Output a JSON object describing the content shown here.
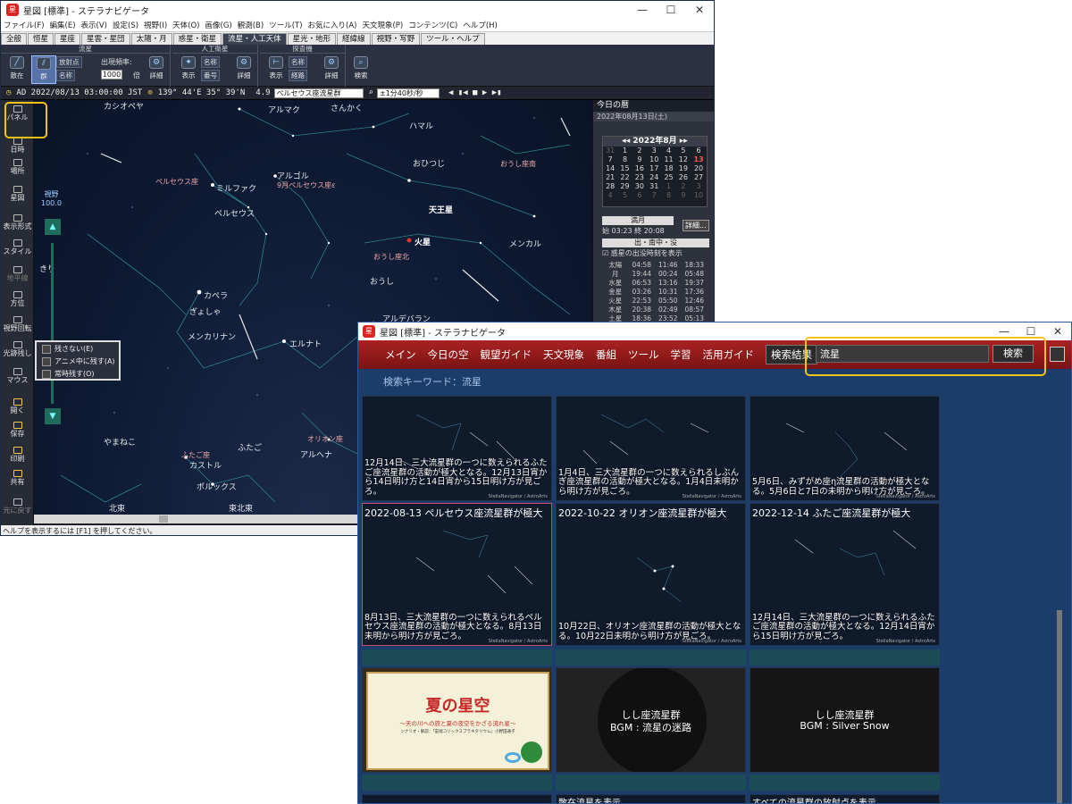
{
  "win1": {
    "title": "星図 [標準] - ステラナビゲータ",
    "menu": [
      "ファイル(F)",
      "編集(E)",
      "表示(V)",
      "設定(S)",
      "視野(I)",
      "天体(O)",
      "画像(G)",
      "観測(B)",
      "ツール(T)",
      "お気に入り(A)",
      "天文現象(P)",
      "コンテンツ(C)",
      "ヘルプ(H)"
    ],
    "tabs": [
      "全般",
      "恒星",
      "星座",
      "星雲・星団",
      "太陽・月",
      "惑星・衛星",
      "流星・人工天体",
      "星光・地形",
      "経緯線",
      "視野・写野",
      "ツール・ヘルプ"
    ],
    "ribbon": {
      "group_meteor": "流星",
      "scatter": "散在",
      "shower": "群",
      "radiant": "放射点",
      "name": "名称",
      "frequency_label": "出現頻率:",
      "frequency_value": "1000",
      "times": "倍",
      "detail": "詳細",
      "group_satellite": "人工衛星",
      "show": "表示",
      "sat_name": "名称",
      "sat_number": "番号",
      "group_probe": "探査機",
      "probe_name": "名称",
      "probe_orbit": "経路",
      "search": "検索"
    },
    "addrbar": {
      "datetime": "AD 2022/08/13 03:00:00 JST",
      "coords": "139° 44'E  35° 39'N",
      "mag": "4.9",
      "target": "ペルセウス座流星群",
      "speed": "±1分40秒/秒"
    },
    "left": [
      {
        "label": "パネル"
      },
      {
        "label": "日時"
      },
      {
        "label": "場所"
      },
      {
        "label": "星図"
      },
      {
        "label": "表示形式"
      },
      {
        "label": "スタイル"
      },
      {
        "label": "地平線"
      },
      {
        "label": "方位"
      },
      {
        "label": "視野回転"
      },
      {
        "label": "光跡残し"
      },
      {
        "label": "マウス"
      },
      {
        "label": "開く"
      },
      {
        "label": "保存"
      },
      {
        "label": "印刷"
      },
      {
        "label": "共有"
      },
      {
        "label": "元に戻す"
      }
    ],
    "fov_label": "視野",
    "fov_value": "100.0",
    "popup": [
      "残さない(E)",
      "アニメ中に残す(A)",
      "常時残す(O)"
    ],
    "sky_labels": [
      {
        "t": "アルマク"
      },
      {
        "t": "さんかく"
      },
      {
        "t": "ハマル"
      },
      {
        "t": "おひつじ"
      },
      {
        "t": "おうし座南"
      },
      {
        "t": "ペルセウス座"
      },
      {
        "t": "ミルファク"
      },
      {
        "t": "アルゴル"
      },
      {
        "t": "9月ペルセウス座ε"
      },
      {
        "t": "天王星"
      },
      {
        "t": "ペルセウス"
      },
      {
        "t": "火星"
      },
      {
        "t": "メンカル"
      },
      {
        "t": "おうし座北"
      },
      {
        "t": "カペラ"
      },
      {
        "t": "おうし"
      },
      {
        "t": "ぎょしゃ"
      },
      {
        "t": "メンカリナン"
      },
      {
        "t": "エルナト"
      },
      {
        "t": "アルデバラン"
      },
      {
        "t": "やまねこ"
      },
      {
        "t": "ふたご座"
      },
      {
        "t": "カストル"
      },
      {
        "t": "ふたご"
      },
      {
        "t": "オリオン座"
      },
      {
        "t": "アルヘナ"
      },
      {
        "t": "ポルックス"
      },
      {
        "t": "北東"
      },
      {
        "t": "東北東"
      },
      {
        "t": "北"
      },
      {
        "t": "カシオペヤ"
      },
      {
        "t": "きり"
      }
    ],
    "status": "ヘルプを表示するには [F1] を押してください。",
    "right": {
      "title": "今日の暦",
      "date": "2022年08月13日(土)",
      "month": "2022年8月",
      "weeks": [
        [
          "31",
          "1",
          "2",
          "3",
          "4",
          "5",
          "6"
        ],
        [
          "7",
          "8",
          "9",
          "10",
          "11",
          "12",
          "13"
        ],
        [
          "14",
          "15",
          "16",
          "17",
          "18",
          "19",
          "20"
        ],
        [
          "21",
          "22",
          "23",
          "24",
          "25",
          "26",
          "27"
        ],
        [
          "28",
          "29",
          "30",
          "31",
          "1",
          "2",
          "3"
        ],
        [
          "4",
          "5",
          "6",
          "7",
          "8",
          "9",
          "10"
        ]
      ],
      "moon_phase": "満月",
      "tide_start": "03:23",
      "tide_end": "20:08",
      "tide_start_label": "始",
      "tide_end_label": "終",
      "detail": "詳細...",
      "rise_header": "出・南中・没",
      "rise_check": "惑星の出没時刻を表示",
      "rows": [
        [
          "太陽",
          "04:58",
          "11:46",
          "18:33"
        ],
        [
          "月",
          "19:44",
          "00:24",
          "05:48"
        ],
        [
          "水星",
          "06:53",
          "13:16",
          "19:37"
        ],
        [
          "金星",
          "03:26",
          "10:31",
          "17:36"
        ],
        [
          "火星",
          "22:53",
          "05:50",
          "12:46"
        ],
        [
          "木星",
          "20:38",
          "02:49",
          "08:57"
        ],
        [
          "土星",
          "18:36",
          "23:52",
          "05:13"
        ]
      ]
    }
  },
  "win2": {
    "title": "星図 [標準] - ステラナビゲータ",
    "nav": [
      "メイン",
      "今日の空",
      "観望ガイド",
      "天文現象",
      "番組",
      "ツール",
      "学習",
      "活用ガイド",
      "検索結果"
    ],
    "search_value": "流星",
    "search_button": "検索",
    "keyword": "検索キーワード：流星",
    "cards": [
      {
        "title": "",
        "desc": "12月14日、三大流星群の一つに数えられるふたご座流星群の活動が極大となる。12月13日宵から14日明け方と14日宵から15日明け方が見ごろ。",
        "credit": "StellaNavigator / AstroArts"
      },
      {
        "title": "",
        "desc": "1月4日、三大流星群の一つに数えられるしぶんぎ座流星群の活動が極大となる。1月4日未明から明け方が見ごろ。",
        "credit": "StellaNavigator / AstroArts"
      },
      {
        "title": "",
        "desc": "5月6日、みずがめ座η流星群の活動が極大となる。5月6日と7日の未明から明け方が見ごろ。",
        "credit": "StellaNavigator / AstroArts"
      },
      {
        "title": "2022-08-13 ペルセウス座流星群が極大",
        "desc": "8月13日、三大流星群の一つに数えられるペルセウス座流星群の活動が極大となる。8月13日未明から明け方が見ごろ。",
        "credit": "StellaNavigator / AstroArts"
      },
      {
        "title": "2022-10-22 オリオン座流星群が極大",
        "desc": "10月22日、オリオン座流星群の活動が極大となる。10月22日未明から明け方が見ごろ。",
        "credit": "StellaNavigator / AstroArts"
      },
      {
        "title": "2022-12-14 ふたご座流星群が極大",
        "desc": "12月14日、三大流星群の一つに数えられるふたご座流星群の活動が極大となる。12月14日宵から15日明け方が見ごろ。",
        "credit": "StellaNavigator / AstroArts"
      }
    ],
    "row3": {
      "summer_title": "夏の星空",
      "summer_sub": "〜天の川への旅と夏の夜空をかざる流れ星〜",
      "summer_credit": "シナリオ・解説：「宙瑞コリックスプラネタリウム」小野田通子",
      "leo1_line1": "しし座流星群",
      "leo1_line2": "BGM : 流星の迷路",
      "leo2_line1": "しし座流星群",
      "leo2_line2": "BGM : Silver Snow"
    },
    "row4": [
      "",
      "散在流星を表示",
      "すべての流星群の放射点を表示"
    ]
  }
}
